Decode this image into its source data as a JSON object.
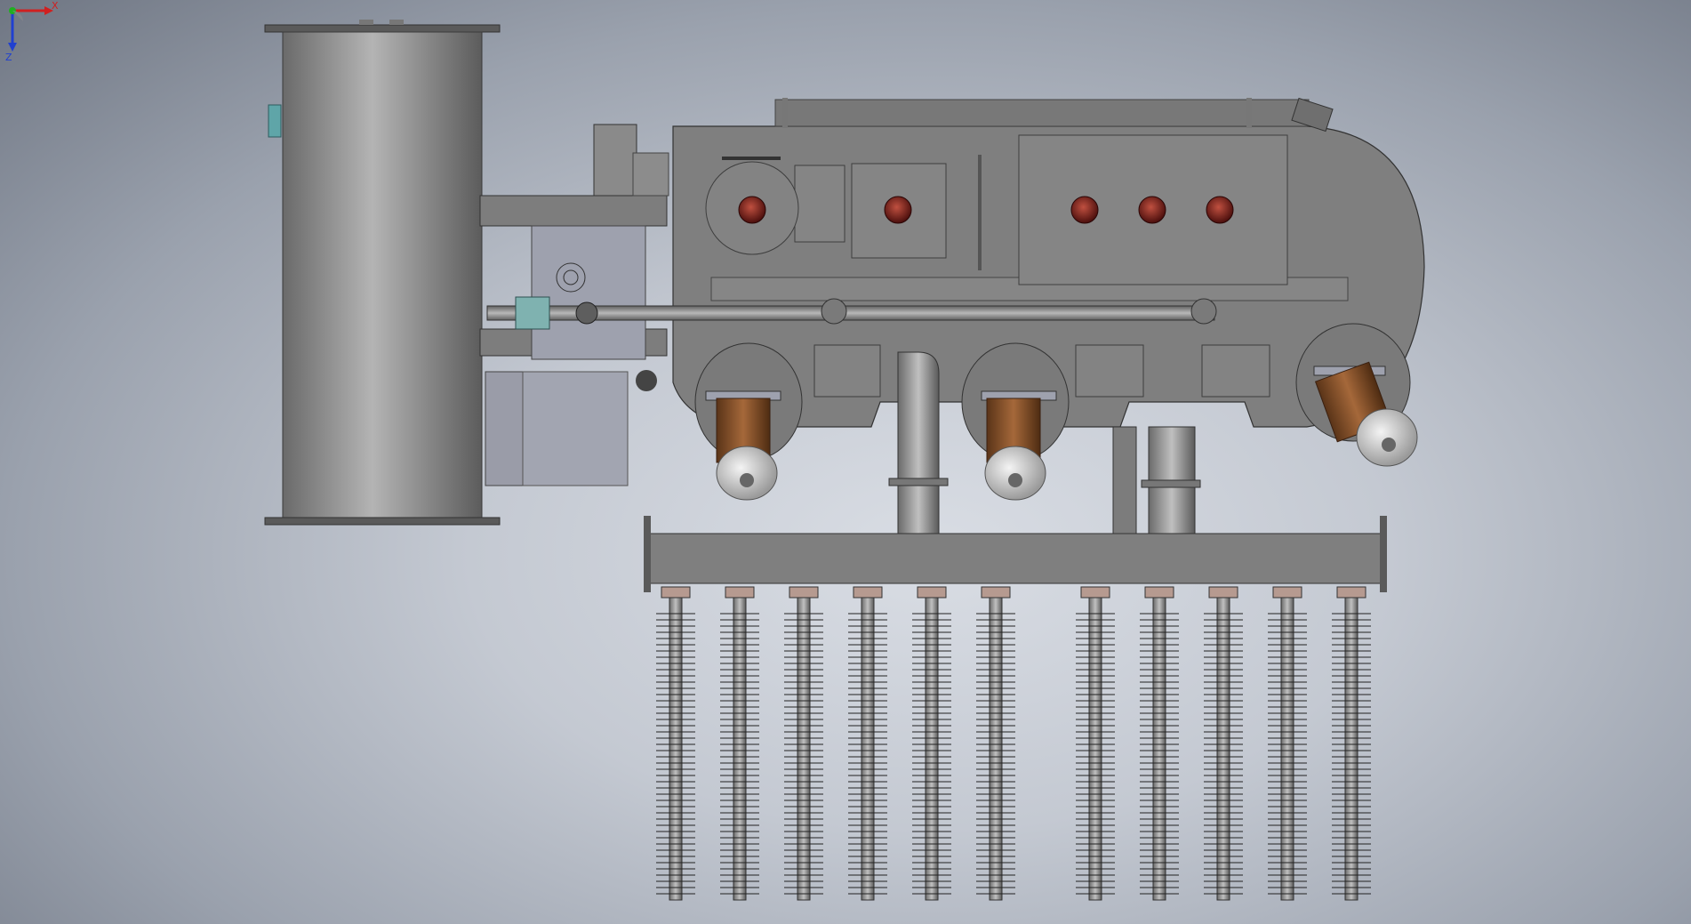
{
  "viewport": {
    "background_top": "#8c94a2",
    "background_center": "#d7dbe2",
    "model_color": "#8a8a8a",
    "model_dark": "#5f5f5f",
    "insulator_color": "#7a2a22",
    "bushing_color": "#7a4a2a"
  },
  "triad": {
    "x_label": "X",
    "z_label": "Z",
    "x_color": "#d02020",
    "y_color": "#20b020",
    "z_color": "#2040d0"
  }
}
